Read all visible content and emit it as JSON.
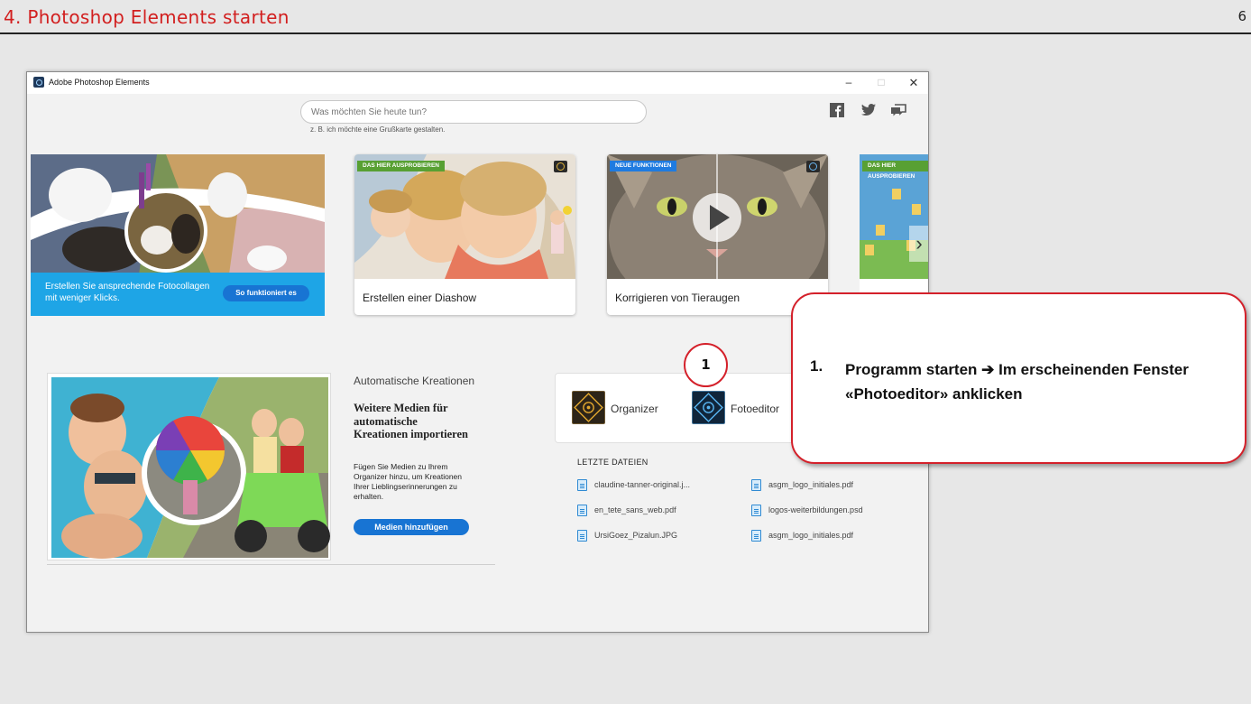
{
  "slide": {
    "title": "4. Photoshop Elements starten",
    "page_number": "6"
  },
  "window": {
    "title": "Adobe Photoshop Elements",
    "minimize": "–",
    "maximize": "□",
    "close": "✕"
  },
  "search": {
    "placeholder": "Was möchten Sie heute tun?",
    "hint": "z. B. ich möchte eine Grußkarte gestalten."
  },
  "social": [
    "facebook-icon",
    "twitter-icon",
    "feedback-icon"
  ],
  "hero": {
    "text": "Erstellen Sie ansprechende Fotocollagen mit weniger Klicks.",
    "button": "So funktioniert es"
  },
  "cards": [
    {
      "badge": "DAS HIER AUSPROBIEREN",
      "label": "Erstellen einer Diashow"
    },
    {
      "badge": "NEUE FUNKTIONEN",
      "label": "Korrigieren von Tieraugen"
    },
    {
      "badge": "DAS HIER AUSPROBIEREN"
    }
  ],
  "auto": {
    "caption": "Automatische Kreationen",
    "heading": "Weitere Medien für automatische Kreationen importieren",
    "body": "Fügen Sie Medien zu Ihrem Organizer hinzu, um Kreationen Ihrer Lieblingserinnerungen zu erhalten.",
    "button": "Medien hinzufügen"
  },
  "launcher": {
    "organizer": "Organizer",
    "fotoeditor": "Fotoeditor"
  },
  "recent": {
    "title": "LETZTE DATEIEN",
    "files": [
      "claudine-tanner-original.j...",
      "asgm_logo_initiales.pdf",
      "en_tete_sans_web.pdf",
      "logos-weiterbildungen.psd",
      "UrsiGoez_Pizalun.JPG",
      "asgm_logo_initiales.pdf"
    ]
  },
  "callout": {
    "step": "1",
    "number": "1.",
    "text": "Programm starten ➔ Im erscheinenden Fenster «Photoeditor» anklicken"
  }
}
